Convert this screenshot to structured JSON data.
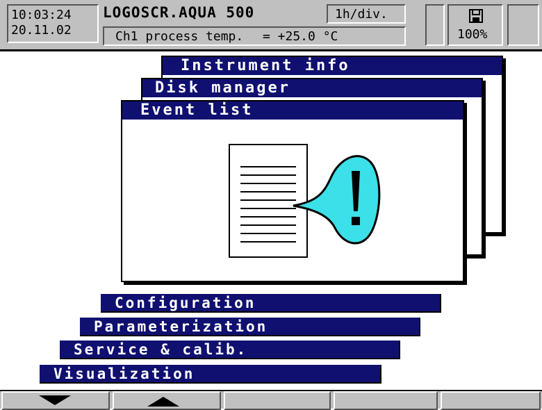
{
  "header": {
    "time": "10:03:24",
    "date": "20.11.02",
    "device_name": "LOGOSCR.AQUA 500",
    "time_division": "1h/div.",
    "channel_label": "Ch1 process temp.",
    "channel_value": "= +25.0 °C",
    "memory_percent": "100%",
    "memory_icon": "floppy-disk-icon"
  },
  "windows": {
    "back": {
      "title": "Instrument info"
    },
    "middle": {
      "title": "Disk manager"
    },
    "front": {
      "title": "Event list"
    }
  },
  "illustration": {
    "document_icon": "document-icon",
    "alert_icon": "alert-speech-bubble-icon"
  },
  "menu": {
    "items": [
      {
        "label": "Configuration"
      },
      {
        "label": "Parameterization"
      },
      {
        "label": "Service & calib."
      },
      {
        "label": "Visualization"
      }
    ]
  },
  "footer": {
    "buttons": [
      {
        "icon": "arrow-down-icon"
      },
      {
        "icon": "arrow-up-icon"
      },
      {
        "icon": ""
      },
      {
        "icon": ""
      },
      {
        "icon": ""
      }
    ]
  },
  "colors": {
    "title_bar": "#101070",
    "panel": "#c0c0c0",
    "alert_fill": "#3ce0e8"
  }
}
